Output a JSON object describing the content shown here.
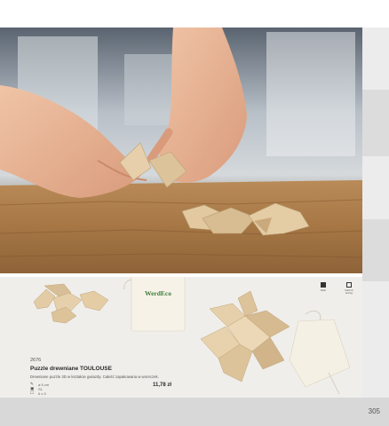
{
  "page": {
    "number": "305"
  },
  "product": {
    "code": "2676",
    "name": "Puzzle drewniane TOULOUSE",
    "description": "Drewniane puzzle 3D w kształcie gwiazdy. Całość zapakowana w woreczek.",
    "specs": [
      {
        "icon": "pencil-icon",
        "text": "ø 5 cm"
      },
      {
        "icon": "print-method-icon",
        "text": "S1"
      },
      {
        "icon": "box-icon",
        "text": "6 x 5"
      }
    ],
    "price": "11,78 zł",
    "bag_print": "WerdEco"
  },
  "badges": [
    {
      "icon": "scissors-icon",
      "caption": "bdsh"
    },
    {
      "icon": "copy-icon",
      "caption": "bdsh rb arning"
    }
  ],
  "colors": {
    "panel_bg": "#efeeea",
    "wood": "#dcc39a",
    "bench": "#a87a4a"
  }
}
